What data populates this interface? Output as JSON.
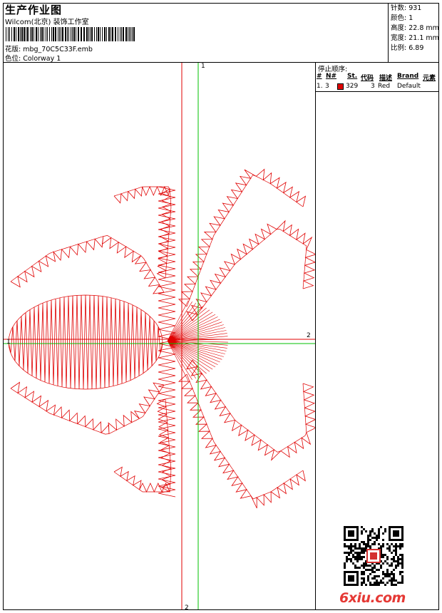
{
  "header": {
    "title": "生产作业图",
    "company": "Wilcom(北京) 装饰工作室",
    "design_label": "花版:",
    "design_value": "mbg_70C5C33F.emb",
    "colorway_label": "色位:",
    "colorway_value": "Colorway 1"
  },
  "stats": {
    "stitches": "针数: 931",
    "colors": "颜色: 1",
    "height": "高度: 22.8 mm",
    "width": "宽度: 21.1 mm",
    "scale": "比例: 6.89"
  },
  "stop_sequence": {
    "title": "停止顺序:",
    "columns": [
      "#",
      "N#",
      "St.",
      "代码",
      "描述",
      "Brand",
      "元素"
    ],
    "rows": [
      {
        "index": "1.",
        "needle": "3",
        "stitches": "329",
        "code": "3",
        "description": "Red",
        "brand": "Default",
        "color": "#e00000"
      }
    ]
  },
  "axes": {
    "top_label": "1",
    "right_label": "2",
    "bottom_label": "2",
    "left_label": "1"
  },
  "colors": {
    "thread": "#e00000",
    "axis_red": "#e00000",
    "axis_green": "#00c000"
  },
  "watermark": {
    "logo_text": "6xiu.com"
  }
}
